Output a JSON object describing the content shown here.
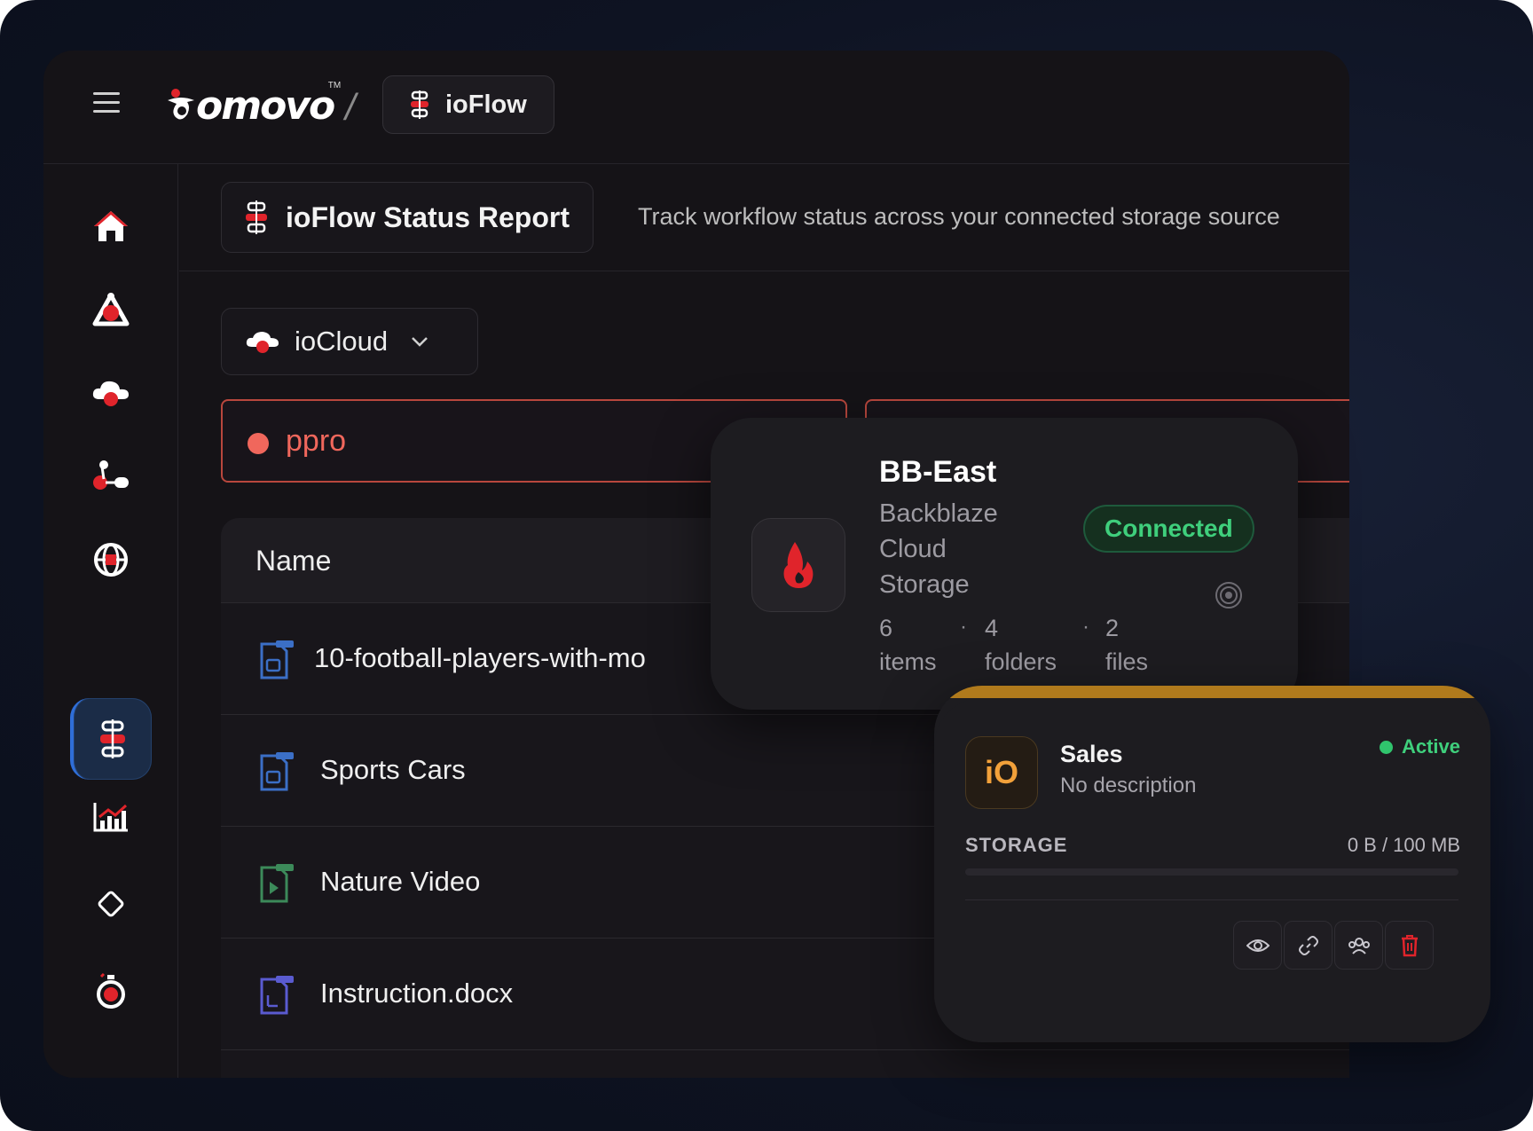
{
  "brand": {
    "logo_text": "omovo",
    "tm": "TM"
  },
  "breadcrumb": {
    "separator": "/",
    "current": "ioFlow"
  },
  "report": {
    "title": "ioFlow Status Report",
    "description": "Track workflow status across your connected storage source"
  },
  "source_select": {
    "value": "ioCloud"
  },
  "filter": {
    "value": "ppro"
  },
  "table": {
    "column_name": "Name",
    "rows": [
      {
        "name": "10-football-players-with-mo",
        "icon": "image-file-icon"
      },
      {
        "name": "Sports Cars",
        "icon": "image-file-icon"
      },
      {
        "name": "Nature Video",
        "icon": "video-file-icon"
      },
      {
        "name": "Instruction.docx",
        "icon": "doc-file-icon"
      }
    ]
  },
  "storage_card": {
    "name": "BB-East",
    "type": "Backblaze Cloud Storage",
    "status": "Connected",
    "items_count": "6",
    "items_label": "items",
    "folders_count": "4",
    "folders_label": "folders",
    "files_count": "2",
    "files_label": "files",
    "sep": "·"
  },
  "workspace_card": {
    "badge": "iO",
    "name": "Sales",
    "description": "No description",
    "status": "Active",
    "storage_label": "STORAGE",
    "storage_value": "0 B / 100 MB",
    "storage_fraction": 0
  },
  "sidebar": {
    "items": [
      "home-icon",
      "network-icon",
      "cloud-icon",
      "workflow-icon",
      "globe-icon",
      "ioflow-icon",
      "analytics-icon",
      "diamond-icon",
      "timer-icon"
    ],
    "active": "ioflow-icon"
  },
  "colors": {
    "accent_red": "#e0242b",
    "status_green": "#3fcf7c",
    "filter_orange": "#f0675c",
    "active_blue": "#2f6ed8",
    "workspace_orange": "#f2a13a"
  }
}
